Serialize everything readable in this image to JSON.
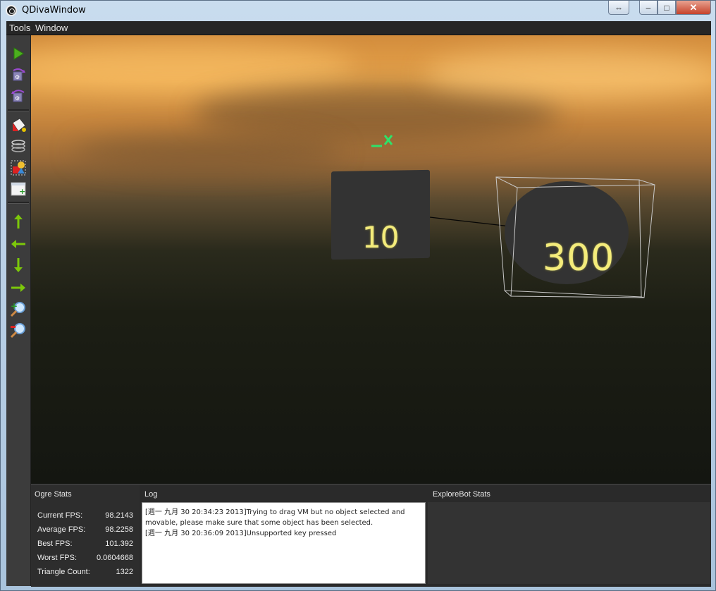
{
  "window": {
    "title": "QDivaWindow",
    "controls": {
      "restore2": "⇔",
      "minimize": "–",
      "maximize": "□",
      "close": "✕"
    }
  },
  "menu": {
    "items": [
      "Tools",
      "Window"
    ]
  },
  "toolbar": {
    "icons": [
      "play-icon",
      "rotate-cw-icon",
      "rotate-ccw-icon",
      "paint-bucket-icon",
      "coil-icon",
      "shapes-icon",
      "add-panel-icon",
      "arrow-up-icon",
      "arrow-left-icon",
      "arrow-down-icon",
      "arrow-right-icon",
      "zoom-in-icon",
      "zoom-out-icon"
    ]
  },
  "scene": {
    "cube_label": "10",
    "sphere_label": "300",
    "label_color": "#f4ec7a",
    "object_color": "#333333"
  },
  "ogre_stats": {
    "title": "Ogre Stats",
    "rows": [
      {
        "label": "Current FPS:",
        "value": "98.2143"
      },
      {
        "label": "Average FPS:",
        "value": "98.2258"
      },
      {
        "label": "Best FPS:",
        "value": "101.392"
      },
      {
        "label": "Worst FPS:",
        "value": "0.0604668"
      },
      {
        "label": "Triangle Count:",
        "value": "1322"
      }
    ]
  },
  "log": {
    "title": "Log",
    "lines": [
      "[週一 九月 30 20:34:23 2013]Trying to drag VM but no object selected and movable, please make sure that some object has been selected.",
      "[週一 九月 30 20:36:09 2013]Unsupported key pressed"
    ]
  },
  "explorebot": {
    "title": "ExploreBot Stats"
  }
}
